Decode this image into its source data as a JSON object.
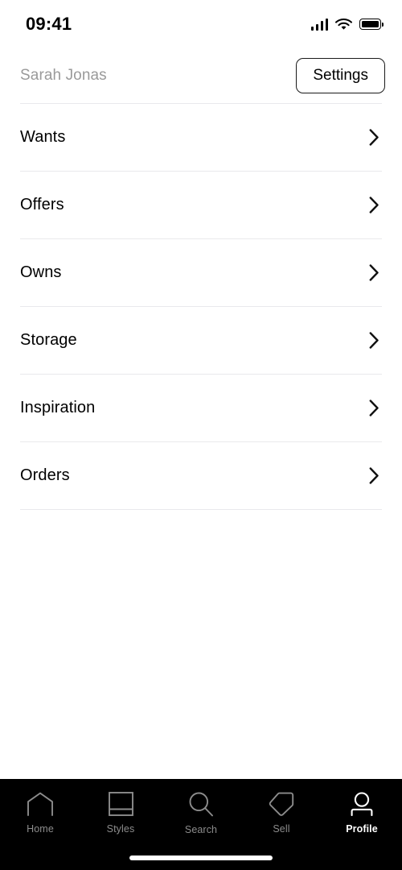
{
  "status_bar": {
    "time": "09:41",
    "icons": {
      "signal": "signal-bars-icon",
      "wifi": "wifi-icon",
      "battery": "battery-full-icon"
    }
  },
  "header": {
    "username": "Sarah Jonas",
    "settings_label": "Settings"
  },
  "menu": {
    "items": [
      {
        "label": "Wants",
        "chevron": "chevron-right-icon"
      },
      {
        "label": "Offers",
        "chevron": "chevron-right-icon"
      },
      {
        "label": "Owns",
        "chevron": "chevron-right-icon"
      },
      {
        "label": "Storage",
        "chevron": "chevron-right-icon"
      },
      {
        "label": "Inspiration",
        "chevron": "chevron-right-icon"
      },
      {
        "label": "Orders",
        "chevron": "chevron-right-icon"
      }
    ]
  },
  "tab_bar": {
    "active": "Profile",
    "tabs": [
      {
        "label": "Home",
        "icon": "home-icon"
      },
      {
        "label": "Styles",
        "icon": "styles-card-icon"
      },
      {
        "label": "Search",
        "icon": "search-icon"
      },
      {
        "label": "Sell",
        "icon": "tag-icon"
      },
      {
        "label": "Profile",
        "icon": "person-icon"
      }
    ]
  },
  "colors": {
    "background": "#ffffff",
    "text_primary": "#000000",
    "text_muted": "#9a9a9a",
    "divider": "#e9e9ec",
    "tabbar_background": "#000000",
    "tab_inactive": "#8c8c8c",
    "tab_active": "#ffffff"
  }
}
